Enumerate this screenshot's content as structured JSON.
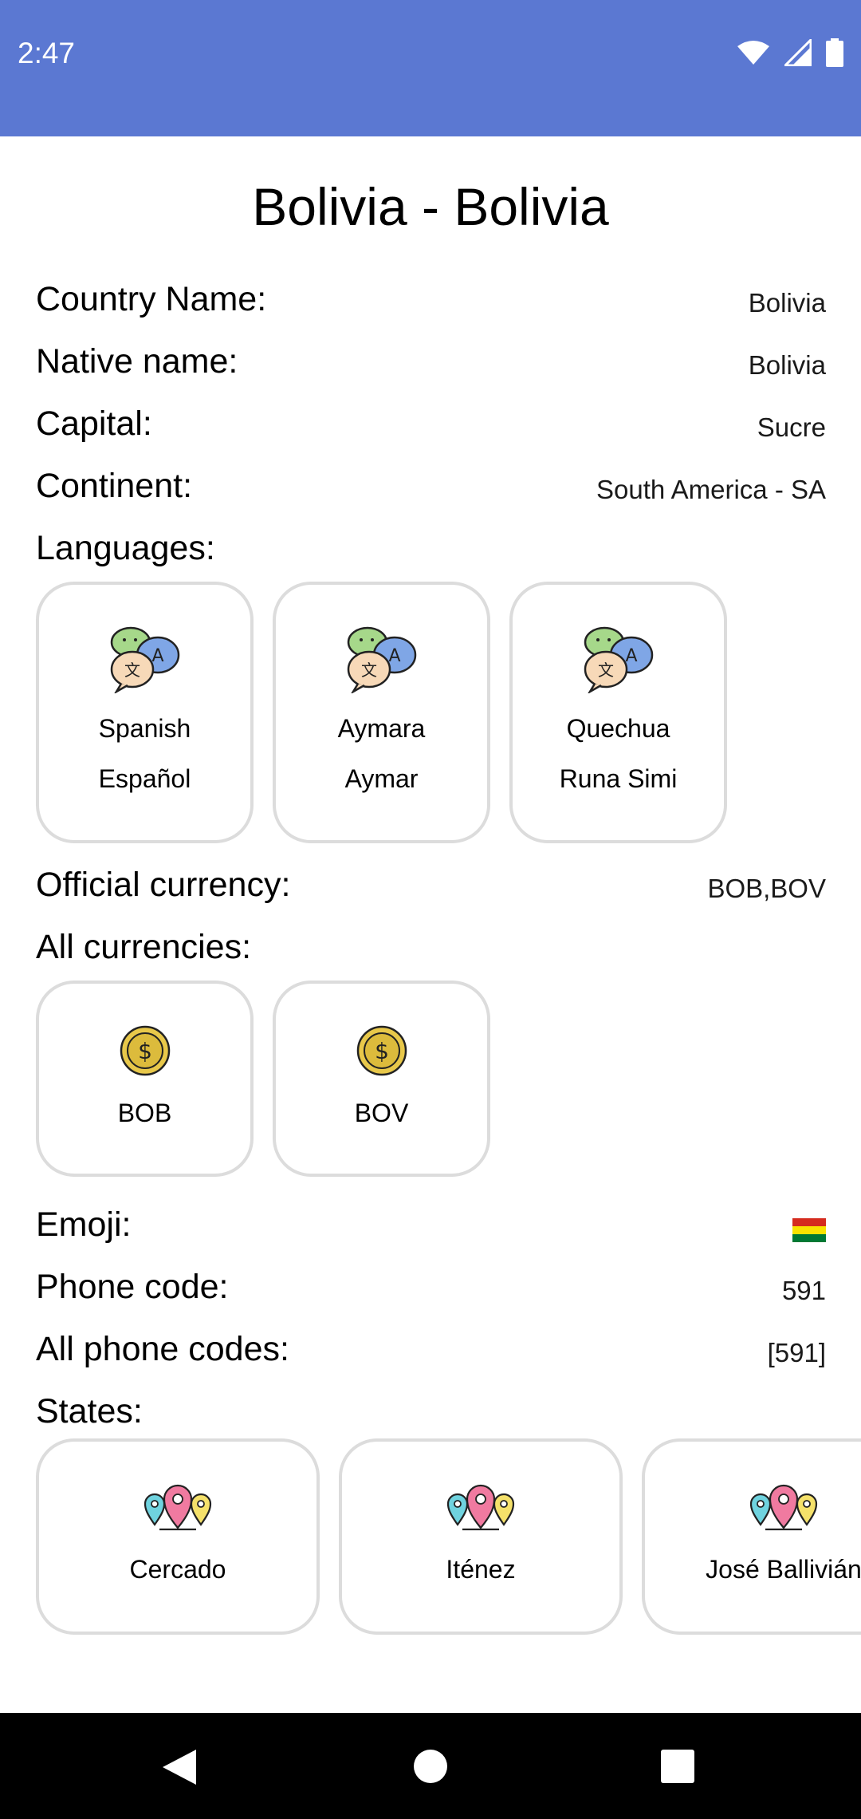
{
  "status": {
    "time": "2:47"
  },
  "title": "Bolivia - Bolivia",
  "fields": {
    "country_name": {
      "label": "Country Name:",
      "value": "Bolivia"
    },
    "native_name": {
      "label": "Native name:",
      "value": "Bolivia"
    },
    "capital": {
      "label": "Capital:",
      "value": "Sucre"
    },
    "continent": {
      "label": "Continent:",
      "value": "South America - SA"
    },
    "official_currency": {
      "label": "Official currency:",
      "value": "BOB,BOV"
    },
    "emoji": {
      "label": "Emoji:",
      "value": "🇧🇴"
    },
    "phone_code": {
      "label": "Phone code:",
      "value": "591"
    },
    "all_phone_codes": {
      "label": "All phone codes:",
      "value": "[591]"
    }
  },
  "languages": {
    "label": "Languages:",
    "items": [
      {
        "name": "Spanish",
        "native": "Español",
        "icon": "translate-icon"
      },
      {
        "name": "Aymara",
        "native": "Aymar",
        "icon": "translate-icon"
      },
      {
        "name": "Quechua",
        "native": "Runa Simi",
        "icon": "translate-icon"
      }
    ]
  },
  "currencies": {
    "label": "All currencies:",
    "items": [
      {
        "code": "BOB",
        "icon": "coin-icon"
      },
      {
        "code": "BOV",
        "icon": "coin-icon"
      }
    ]
  },
  "states": {
    "label": "States:",
    "items": [
      {
        "name": "Cercado",
        "icon": "map-pins-icon"
      },
      {
        "name": "Iténez",
        "icon": "map-pins-icon"
      },
      {
        "name": "José Ballivián",
        "icon": "map-pins-icon"
      }
    ]
  },
  "colors": {
    "status_bar": "#5b78d2",
    "card_border": "#dcdcdc",
    "nav_bar": "#000000"
  }
}
